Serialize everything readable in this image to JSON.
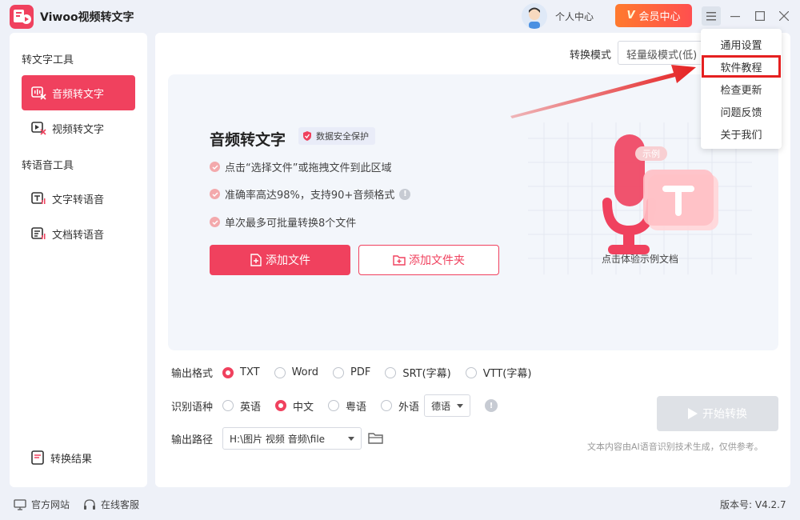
{
  "app": {
    "title": "Viwoo视频转文字"
  },
  "header": {
    "profile_label": "个人中心",
    "vip_label": "会员中心",
    "vip_mark": "V"
  },
  "sidebar": {
    "section1": "转文字工具",
    "section2": "转语音工具",
    "items": [
      {
        "label": "音频转文字",
        "icon": "audio-to-text-icon",
        "active": true
      },
      {
        "label": "视频转文字",
        "icon": "video-to-text-icon",
        "active": false
      },
      {
        "label": "文字转语音",
        "icon": "text-to-speech-icon",
        "active": false
      },
      {
        "label": "文档转语音",
        "icon": "doc-to-speech-icon",
        "active": false
      }
    ],
    "result_label": "转换结果"
  },
  "main": {
    "mode_label": "转换模式",
    "mode_value": "轻量级模式(低)",
    "title": "音频转文字",
    "badge": "数据安全保护",
    "features": [
      "点击“选择文件”或拖拽文件到此区域",
      "准确率高达98%，支持90+音频格式",
      "单次最多可批量转换8个文件"
    ],
    "add_file": "添加文件",
    "add_folder": "添加文件夹",
    "example_tag": "示例",
    "example_label": "点击体验示例文档"
  },
  "options": {
    "format_label": "输出格式",
    "formats": [
      {
        "label": "TXT",
        "selected": true
      },
      {
        "label": "Word",
        "selected": false
      },
      {
        "label": "PDF",
        "selected": false
      },
      {
        "label": "SRT(字幕)",
        "selected": false
      },
      {
        "label": "VTT(字幕)",
        "selected": false
      }
    ],
    "lang_label": "识别语种",
    "languages": [
      {
        "label": "英语",
        "selected": false
      },
      {
        "label": "中文",
        "selected": true
      },
      {
        "label": "粤语",
        "selected": false
      },
      {
        "label": "外语",
        "selected": false
      }
    ],
    "foreign_select": "德语",
    "path_label": "输出路径",
    "path_value": "H:\\图片 视频 音频\\file"
  },
  "start_label": "开始转换",
  "disclaimer": "文本内容由AI语音识别技术生成，仅供参考。",
  "footer": {
    "website": "官方网站",
    "service": "在线客服",
    "version": "版本号: V4.2.7"
  },
  "menu": {
    "items": [
      "通用设置",
      "软件教程",
      "检查更新",
      "问题反馈",
      "关于我们"
    ],
    "highlighted": "软件教程"
  },
  "colors": {
    "accent": "#f0415e",
    "annotation": "#e52020",
    "vip": "#ff6a3a"
  }
}
